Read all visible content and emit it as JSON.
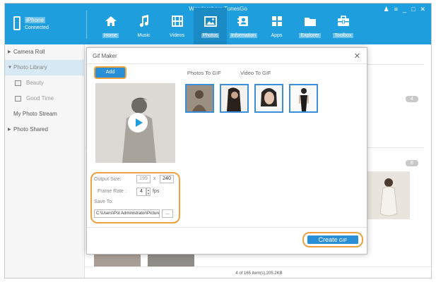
{
  "app": {
    "title": "Wondershare TunesGo"
  },
  "window_controls": [
    "user-icon",
    "menu-icon",
    "minimize-icon",
    "maximize-icon",
    "close-icon"
  ],
  "window_glyphs": {
    "user": "♟",
    "menu": "≡",
    "minimize": "_",
    "maximize": "□",
    "close": "✕"
  },
  "device": {
    "name": "iPhone",
    "status": "Connected"
  },
  "nav": [
    {
      "label": "Home",
      "icon": "home-icon"
    },
    {
      "label": "Music",
      "icon": "music-icon"
    },
    {
      "label": "Videos",
      "icon": "video-icon"
    },
    {
      "label": "Photos",
      "icon": "photo-icon"
    },
    {
      "label": "Information",
      "icon": "contacts-icon"
    },
    {
      "label": "Apps",
      "icon": "apps-icon"
    },
    {
      "label": "Explorer",
      "icon": "folder-icon"
    },
    {
      "label": "Toolbox",
      "icon": "toolbox-icon"
    }
  ],
  "sidebar": {
    "items": [
      {
        "label": "Camera Roll",
        "arrow": "▶"
      },
      {
        "label": "Photo Library",
        "arrow": "▼"
      },
      {
        "label": "Beauty"
      },
      {
        "label": "Good Time"
      },
      {
        "label": "My Photo Stream"
      },
      {
        "label": "Photo Shared",
        "arrow": "▶"
      }
    ]
  },
  "main": {
    "badges": [
      "4",
      "8"
    ],
    "status": "4 of 165 item(s),205.2KB"
  },
  "dialog": {
    "title": "Gif Maker",
    "close": "✕",
    "add_label": "Add",
    "tabs": [
      "Photos To GIF",
      "Video To GIF"
    ],
    "output_size_label": "Output Size:",
    "width": "199",
    "by": "x",
    "height": "240",
    "frame_rate_label": "Frame Rate :",
    "frame_rate": "4",
    "fps": "fps",
    "spin_up": "▲",
    "spin_down": "▼",
    "save_to_label": "Save To:",
    "save_path": "C:\\Users\\Pst Administrator\\Pictures\\",
    "browse": "...",
    "create_big": "Create",
    "create_small": "GIF"
  },
  "colors": {
    "header": "#1f9ede",
    "accent": "#2a8fd6",
    "highlight": "#f0a040"
  }
}
